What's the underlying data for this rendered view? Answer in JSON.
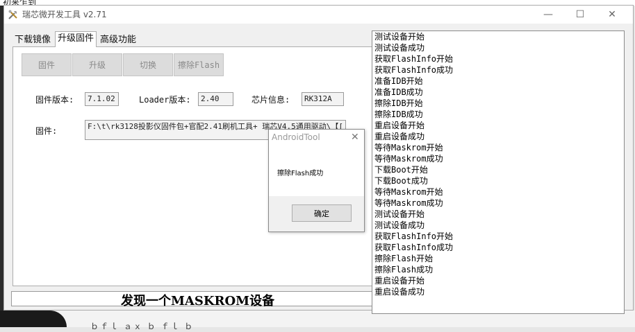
{
  "background": {
    "top_text": "初来乍到",
    "bottom_text": "ｂｆｌ ａｘ ｂ ｆｌ ｂ"
  },
  "window": {
    "title": "瑞芯微开发工具 v2.71",
    "controls": {
      "minimize": "—",
      "maximize": "☐",
      "close": "✕"
    }
  },
  "tabs": [
    {
      "label": "下载镜像",
      "active": false
    },
    {
      "label": "升级固件",
      "active": true
    },
    {
      "label": "高级功能",
      "active": false
    }
  ],
  "toolbar": {
    "firmware_label": "固件",
    "upgrade_label": "升级",
    "switch_label": "切换",
    "erase_label": "擦除Flash"
  },
  "info": {
    "firmware_version_label": "固件版本:",
    "firmware_version": "7.1.02",
    "loader_version_label": "Loader版本:",
    "loader_version": "2.40",
    "chip_info_label": "芯片信息:",
    "chip_info": "RK312A",
    "firmware_path_label": "固件:",
    "firmware_path": "F:\\t\\rk3128投影仪固件包+官配2.41刷机工具+ 瑞芯V4.5通用驱动\\【["
  },
  "status": "发现一个MASKROM设备",
  "log": [
    "测试设备开始",
    "测试设备成功",
    "获取FlashInfo开始",
    "获取FlashInfo成功",
    "准备IDB开始",
    "准备IDB成功",
    "擦除IDB开始",
    "擦除IDB成功",
    "重启设备开始",
    "重启设备成功",
    "等待Maskrom开始",
    "等待Maskrom成功",
    "下载Boot开始",
    "下载Boot成功",
    "等待Maskrom开始",
    "等待Maskrom成功",
    "测试设备开始",
    "测试设备成功",
    "获取FlashInfo开始",
    "获取FlashInfo成功",
    "擦除Flash开始",
    "擦除Flash成功",
    "重启设备开始",
    "重启设备成功"
  ],
  "dialog": {
    "title": "AndroidTool",
    "close": "✕",
    "message": "擦除Flash成功",
    "ok_label": "确定"
  }
}
